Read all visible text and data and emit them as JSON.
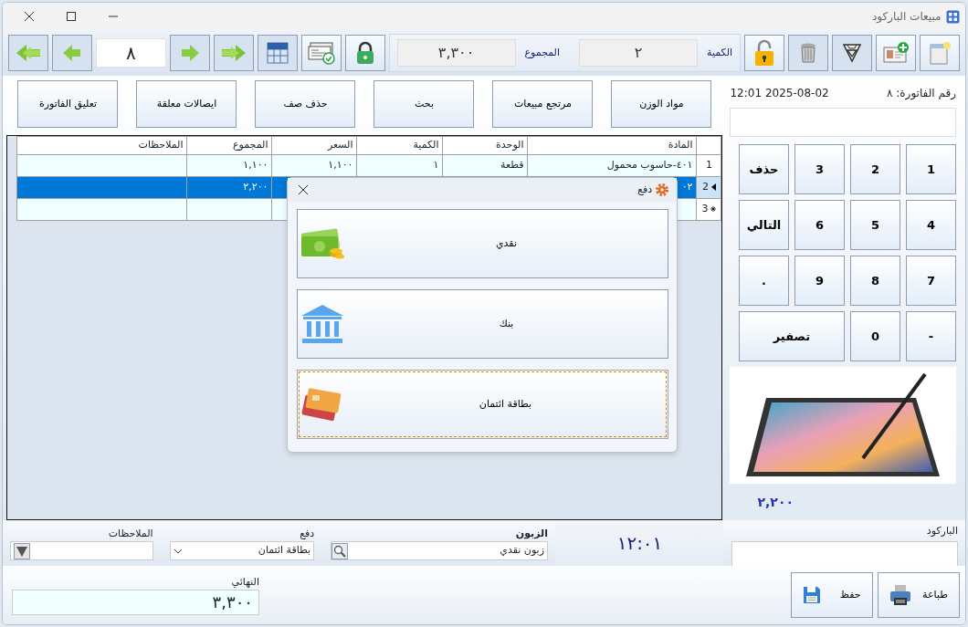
{
  "window": {
    "title": "مبيعات الباركود"
  },
  "toolbar": {
    "record_number": "٨",
    "quantity_label": "الكمية",
    "quantity": "٢",
    "total_label": "المجموع",
    "total": "٣,٣٠٠"
  },
  "actions": [
    "مواد الوزن",
    "مرتجع مبيعات",
    "بحث",
    "حذف صف",
    "ايصالات معلقة",
    "تعليق الفاتورة"
  ],
  "invoice": {
    "number_label": "رقم الفاتورة: ٨",
    "datetime": "2025-08-02 12:01"
  },
  "keypad": [
    {
      "label": "1",
      "kind": "key"
    },
    {
      "label": "2",
      "kind": "key"
    },
    {
      "label": "3",
      "kind": "key"
    },
    {
      "label": "حذف",
      "kind": "key"
    },
    {
      "label": "4",
      "kind": "key"
    },
    {
      "label": "5",
      "kind": "key"
    },
    {
      "label": "6",
      "kind": "key"
    },
    {
      "label": "التالي",
      "kind": "key"
    },
    {
      "label": "7",
      "kind": "key"
    },
    {
      "label": "8",
      "kind": "key"
    },
    {
      "label": "9",
      "kind": "key"
    },
    {
      "label": ".",
      "kind": "key"
    },
    {
      "label": "-",
      "kind": "key"
    },
    {
      "label": "0",
      "kind": "key"
    },
    {
      "label": "تصفير",
      "kind": "wide"
    }
  ],
  "product_total": "٢,٢٠٠",
  "table": {
    "columns": [
      "المادة",
      "الوحدة",
      "الكمية",
      "السعر",
      "المجموع",
      "الملاحظات"
    ],
    "rows": [
      {
        "marker": "1",
        "kind": "item",
        "selected": false,
        "cells": [
          "٤٠١-حاسوب محمول",
          "قطعة",
          "١",
          "١,١٠٠",
          "١,١٠٠",
          null
        ]
      },
      {
        "marker": "2",
        "kind": "item",
        "selected": true,
        "cells": [
          "٠٢",
          null,
          null,
          null,
          "٢,٢٠٠",
          null
        ]
      },
      {
        "marker": "3",
        "kind": "new",
        "selected": false,
        "cells": [
          null,
          null,
          null,
          null,
          null,
          null
        ]
      }
    ]
  },
  "payment_dialog": {
    "title": "دفع",
    "options": [
      {
        "label": "نقدي",
        "kind": "cash",
        "selected": false
      },
      {
        "label": "بنك",
        "kind": "bank",
        "selected": false
      },
      {
        "label": "بطاقة ائتمان",
        "kind": "card",
        "selected": true
      }
    ]
  },
  "bottom": {
    "customer_label": "الزبون",
    "customer": "زبون نقدي",
    "payment_label": "دفع",
    "payment": "بطاقة ائتمان",
    "notes_label": "الملاحظات",
    "clock": "١٢:٠١",
    "barcode_label": "الباركود"
  },
  "final": {
    "label": "النهائي",
    "value": "٣,٣٠٠"
  },
  "buttons": [
    {
      "label": "طباعة",
      "kind": "print"
    },
    {
      "label": "حفظ",
      "kind": "save"
    }
  ]
}
